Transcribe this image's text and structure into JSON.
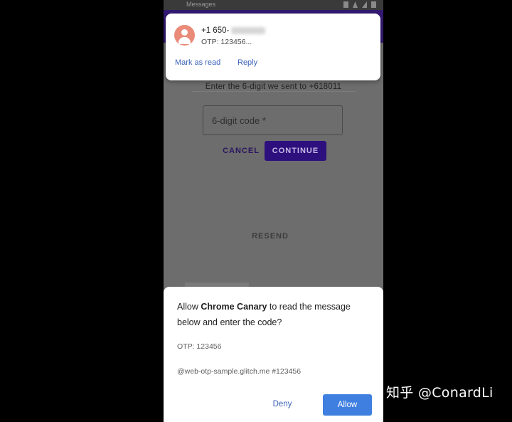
{
  "status_bar": {
    "text": "Messages"
  },
  "page": {
    "instruction": "Enter the 6-digit we sent to +618011",
    "code_placeholder": "6-digit code *",
    "cancel_label": "CANCEL",
    "continue_label": "CONTINUE",
    "resend_label": "RESEND"
  },
  "notification": {
    "sender": "+1 650-",
    "preview": "OTP: 123456...",
    "actions": [
      "Mark as read",
      "Reply"
    ],
    "avatar_color": "#ea8a78",
    "icon": "person-icon"
  },
  "sheet": {
    "q_prefix": "Allow ",
    "q_app": "Chrome Canary",
    "q_suffix": " to read the message below and enter the code?",
    "otp": "OTP: 123456",
    "origin": "@web-otp-sample.glitch.me #123456",
    "deny_label": "Deny",
    "allow_label": "Allow"
  },
  "colors": {
    "accent": "#3f7fe0",
    "primary_dark": "#331973",
    "link": "#3b63b8"
  },
  "watermark": "知乎 @ConardLi"
}
